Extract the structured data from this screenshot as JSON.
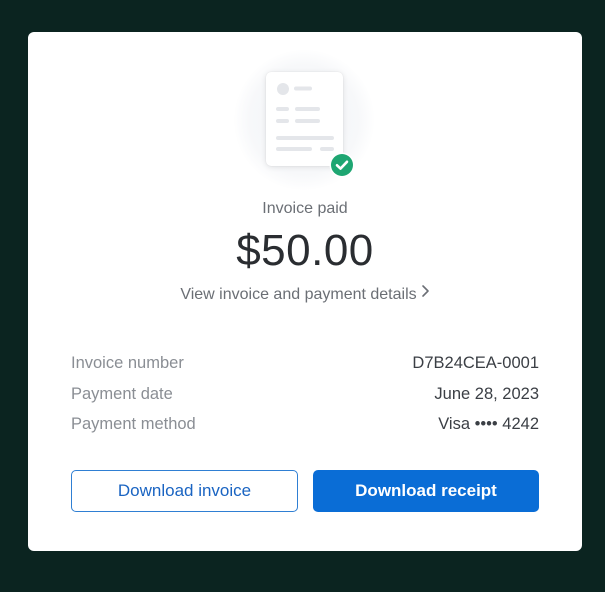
{
  "invoice": {
    "status": "Invoice paid",
    "amount": "$50.00",
    "details_link": "View invoice and payment details"
  },
  "fields": [
    {
      "label": "Invoice number",
      "value": "D7B24CEA-0001"
    },
    {
      "label": "Payment date",
      "value": "June 28, 2023"
    },
    {
      "label": "Payment method",
      "value": "Visa •••• 4242"
    }
  ],
  "actions": {
    "download_invoice": "Download invoice",
    "download_receipt": "Download receipt"
  },
  "icons": {
    "document": "invoice-document-icon",
    "check": "check-circle-icon",
    "chevron": "chevron-right-icon"
  },
  "colors": {
    "background": "#0b2420",
    "primary": "#0a6dd6",
    "success": "#1ea672"
  }
}
